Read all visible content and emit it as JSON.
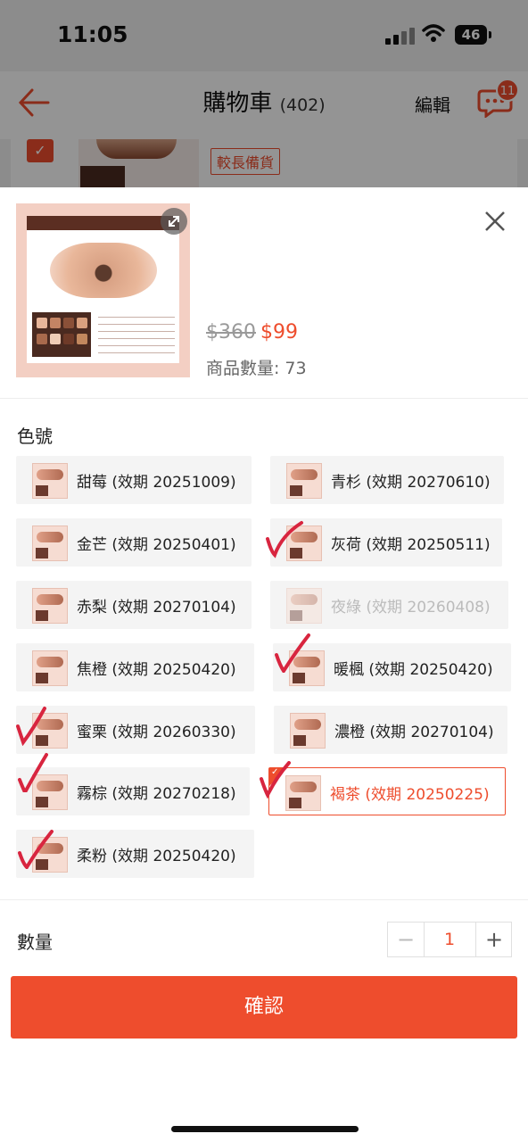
{
  "status_bar": {
    "time": "11:05",
    "battery": "46"
  },
  "header": {
    "title": "購物車",
    "count": "(402)",
    "edit": "編輯",
    "chat_badge": "11"
  },
  "cart_item": {
    "tag": "較長備貨"
  },
  "product": {
    "old_price": "$360",
    "price": "$99",
    "stock_label": "商品數量:",
    "stock_value": "73"
  },
  "variants": {
    "label": "色號",
    "options": [
      {
        "label": "甜莓 (效期 20251009)",
        "state": "normal"
      },
      {
        "label": "青杉 (效期 20270610)",
        "state": "normal"
      },
      {
        "label": "金芒 (效期 20250401)",
        "state": "normal"
      },
      {
        "label": "灰荷 (效期 20250511)",
        "state": "normal"
      },
      {
        "label": "赤梨 (效期 20270104)",
        "state": "normal"
      },
      {
        "label": "夜綠 (效期 20260408)",
        "state": "disabled"
      },
      {
        "label": "焦橙 (效期 20250420)",
        "state": "normal"
      },
      {
        "label": "暖楓 (效期 20250420)",
        "state": "normal"
      },
      {
        "label": "蜜栗 (效期 20260330)",
        "state": "normal"
      },
      {
        "label": "濃橙 (效期 20270104)",
        "state": "normal"
      },
      {
        "label": "霧棕 (效期 20270218)",
        "state": "normal"
      },
      {
        "label": "褐茶 (效期 20250225)",
        "state": "selected"
      },
      {
        "label": "柔粉 (效期 20250420)",
        "state": "normal"
      }
    ]
  },
  "quantity": {
    "label": "數量",
    "minus": "−",
    "value": "1",
    "plus": "+"
  },
  "confirm_button": "確認",
  "colors": {
    "accent": "#ee4d2d",
    "handwritten_mark": "#d8253f"
  }
}
